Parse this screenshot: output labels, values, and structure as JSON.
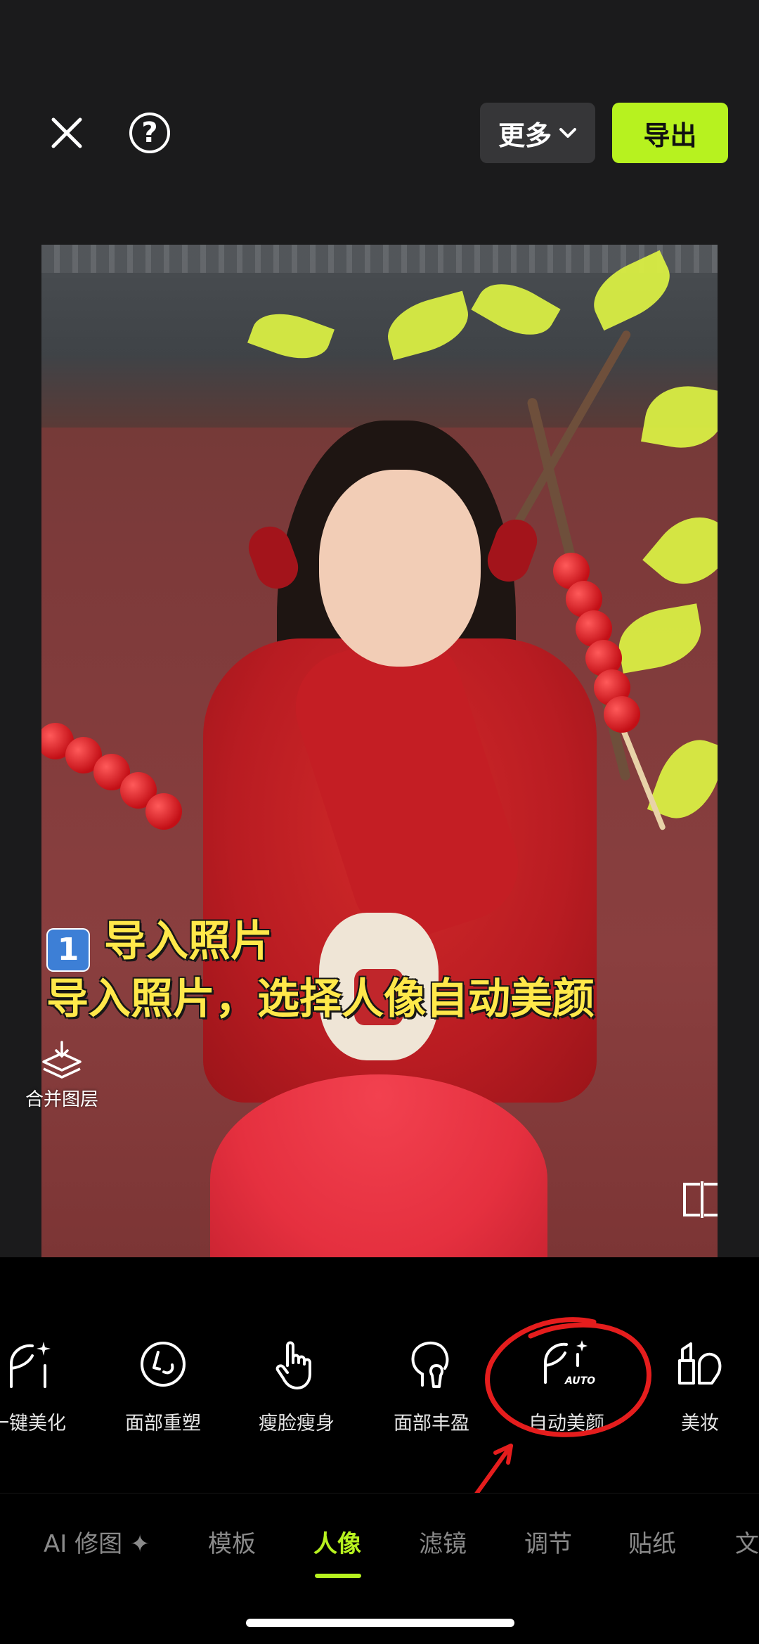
{
  "toolbar": {
    "more_label": "更多",
    "export_label": "导出",
    "help_symbol": "?"
  },
  "overlay": {
    "step_badge": "1",
    "caption_line1": "导入照片",
    "caption_line2": "导入照片，选择人像自动美颜"
  },
  "photo_actions": {
    "merge_layers_label": "合并图层"
  },
  "tools": [
    {
      "label": "一键美化",
      "icon": "face-sparkle-icon"
    },
    {
      "label": "面部重塑",
      "icon": "face-reshape-icon"
    },
    {
      "label": "瘦脸瘦身",
      "icon": "hand-pointer-icon"
    },
    {
      "label": "面部丰盈",
      "icon": "face-fill-icon"
    },
    {
      "label": "自动美颜",
      "icon": "auto-beauty-icon"
    },
    {
      "label": "美妆",
      "icon": "makeup-icon"
    }
  ],
  "tabs": [
    {
      "label": "AI 修图 ✦"
    },
    {
      "label": "模板"
    },
    {
      "label": "人像",
      "active": true
    },
    {
      "label": "滤镜"
    },
    {
      "label": "调节"
    },
    {
      "label": "贴纸"
    },
    {
      "label": "文"
    }
  ],
  "colors": {
    "accent": "#b7f21f",
    "annotation": "#e51d1d",
    "caption": "#ffe84a"
  }
}
